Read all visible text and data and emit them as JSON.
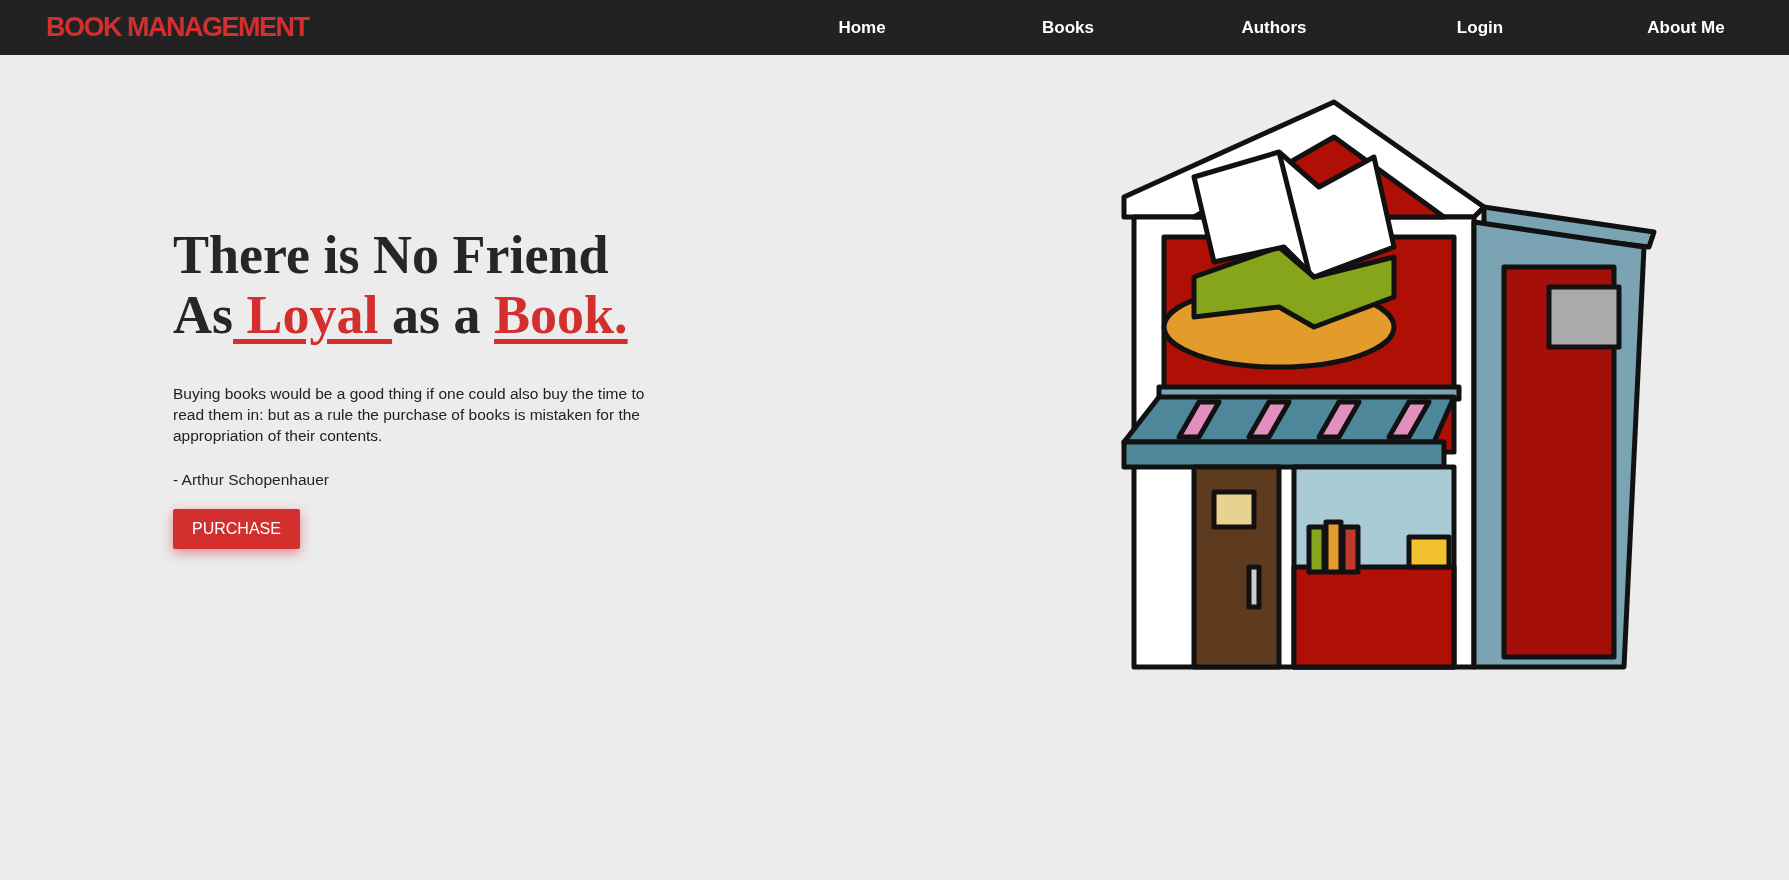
{
  "navbar": {
    "logo": "BOOK MANAGEMENT",
    "links": [
      {
        "label": "Home"
      },
      {
        "label": "Books"
      },
      {
        "label": "Authors"
      },
      {
        "label": "Login"
      },
      {
        "label": "About Me"
      }
    ]
  },
  "hero": {
    "headline": [
      {
        "kind": "plain",
        "text": "There is No Friend"
      },
      {
        "kind": "break"
      },
      {
        "kind": "plain",
        "text": "As"
      },
      {
        "kind": "accent",
        "text": " Loyal "
      },
      {
        "kind": "plain",
        "text": "as a "
      },
      {
        "kind": "accent",
        "text": "Book."
      }
    ],
    "quote": "Buying books would be a good thing if one could also buy the time to read them in: but as a rule the purchase of books is mistaken for the appropriation of their contents.",
    "author": "- Arthur Schopenhauer",
    "button": "PURCHASE"
  }
}
